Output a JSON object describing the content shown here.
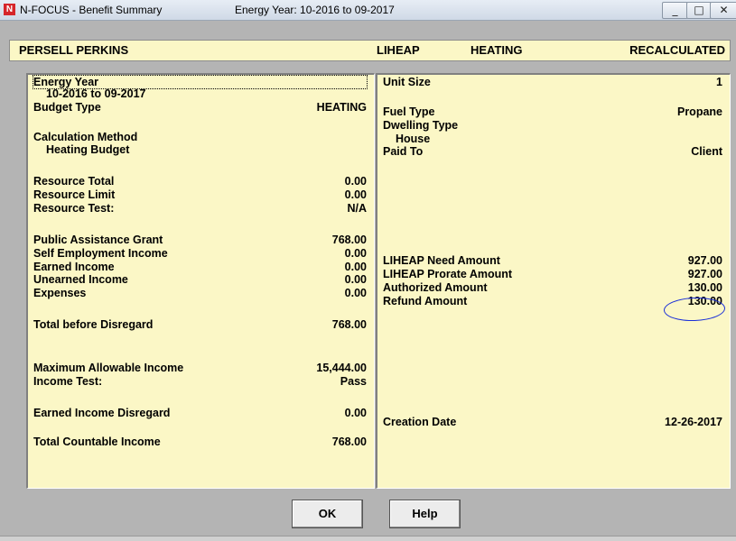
{
  "window": {
    "title": "N-FOCUS - Benefit Summary",
    "title_year": "Energy Year:  10-2016 to 09-2017"
  },
  "header": {
    "name": "PERSELL PERKINS",
    "program": "LIHEAP",
    "category": "HEATING",
    "status": "RECALCULATED"
  },
  "left": {
    "energy_year_label": "Energy Year",
    "energy_year_value": "10-2016 to 09-2017",
    "budget_type_label": "Budget Type",
    "budget_type_value": "HEATING",
    "calc_method_label": "Calculation Method",
    "calc_method_value": "Heating Budget",
    "resource_total_label": "Resource Total",
    "resource_total_value": "0.00",
    "resource_limit_label": "Resource Limit",
    "resource_limit_value": "0.00",
    "resource_test_label": "Resource Test:",
    "resource_test_value": "N/A",
    "pa_grant_label": "Public Assistance Grant",
    "pa_grant_value": "768.00",
    "self_emp_label": "Self Employment Income",
    "self_emp_value": "0.00",
    "earned_label": "Earned Income",
    "earned_value": "0.00",
    "unearned_label": "Unearned Income",
    "unearned_value": "0.00",
    "expenses_label": "Expenses",
    "expenses_value": "0.00",
    "total_before_label": "Total before Disregard",
    "total_before_value": "768.00",
    "max_allow_label": "Maximum Allowable Income",
    "max_allow_value": "15,444.00",
    "income_test_label": "Income Test:",
    "income_test_value": "Pass",
    "earned_disregard_label": "Earned Income Disregard",
    "earned_disregard_value": "0.00",
    "total_countable_label": "Total Countable Income",
    "total_countable_value": "768.00"
  },
  "right": {
    "unit_size_label": "Unit Size",
    "unit_size_value": "1",
    "fuel_type_label": "Fuel Type",
    "fuel_type_value": "Propane",
    "dwelling_label": "Dwelling Type",
    "dwelling_value": "House",
    "paid_to_label": "Paid To",
    "paid_to_value": "Client",
    "need_label": "LIHEAP Need Amount",
    "need_value": "927.00",
    "prorate_label": "LIHEAP Prorate Amount",
    "prorate_value": "927.00",
    "authorized_label": "Authorized Amount",
    "authorized_value": "130.00",
    "refund_label": "Refund Amount",
    "refund_value": "130.00",
    "creation_label": "Creation Date",
    "creation_value": "12-26-2017"
  },
  "buttons": {
    "ok": "OK",
    "help": "Help"
  },
  "colors": {
    "panel_bg": "#fbf7c6",
    "annotation": "#1a2fd8",
    "app_icon": "#d6252a"
  }
}
